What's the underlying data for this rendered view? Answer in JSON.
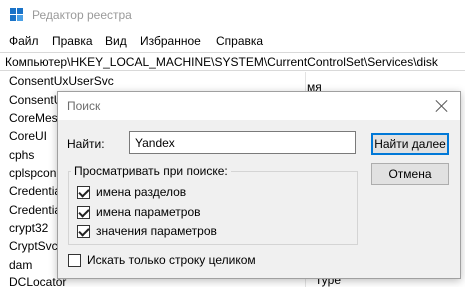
{
  "window": {
    "title": "Редактор реестра",
    "icon": "registry-editor-icon"
  },
  "menu": [
    "Файл",
    "Правка",
    "Вид",
    "Избранное",
    "Справка"
  ],
  "address": "Компьютер\\HKEY_LOCAL_MACHINE\\SYSTEM\\CurrentControlSet\\Services\\disk",
  "tree": [
    "ConsentUxUserSvc",
    "ConsentU",
    "CoreMess",
    "CoreUI",
    "cphs",
    "cplspcon",
    "Credentia",
    "Credentia",
    "crypt32",
    "CryptSvc",
    "dam",
    "DCLocator"
  ],
  "right_pane": {
    "header_fragment": "мя",
    "type_fragment": "Type"
  },
  "dialog": {
    "title": "Поиск",
    "find_label": "Найти:",
    "find_value": "Yandex",
    "find_next_label": "Найти далее",
    "cancel_label": "Отмена",
    "look_at_legend": "Просматривать при поиске:",
    "options": [
      {
        "label": "имена разделов",
        "checked": true
      },
      {
        "label": "имена параметров",
        "checked": true
      },
      {
        "label": "значения параметров",
        "checked": true
      }
    ],
    "whole_string": {
      "label": "Искать только строку целиком",
      "checked": false
    }
  }
}
